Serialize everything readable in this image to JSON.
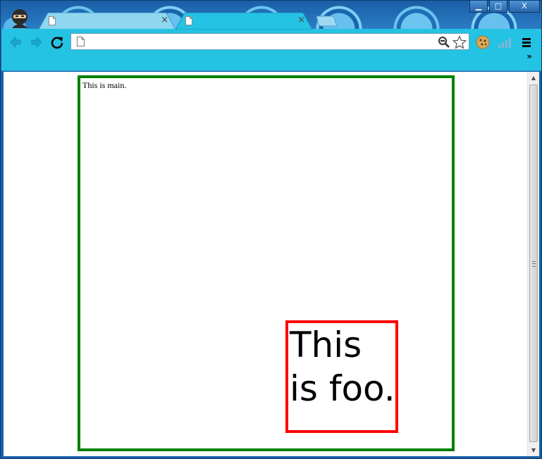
{
  "window": {
    "controls": {
      "minimize": "▁",
      "maximize": "□",
      "close": "X"
    }
  },
  "tabs": [
    {
      "title": "",
      "close": "×",
      "active": false
    },
    {
      "title": "",
      "close": "×",
      "active": true
    }
  ],
  "toolbar": {
    "address_value": "",
    "overflow": "»"
  },
  "page": {
    "main_text": "This is main.",
    "foo_text": "This is foo."
  },
  "scrollbar": {
    "up": "▲",
    "down": "▼"
  },
  "colors": {
    "toolbar_bg": "#25c3e3",
    "main_border": "#008000",
    "foo_border": "#ff0000"
  }
}
